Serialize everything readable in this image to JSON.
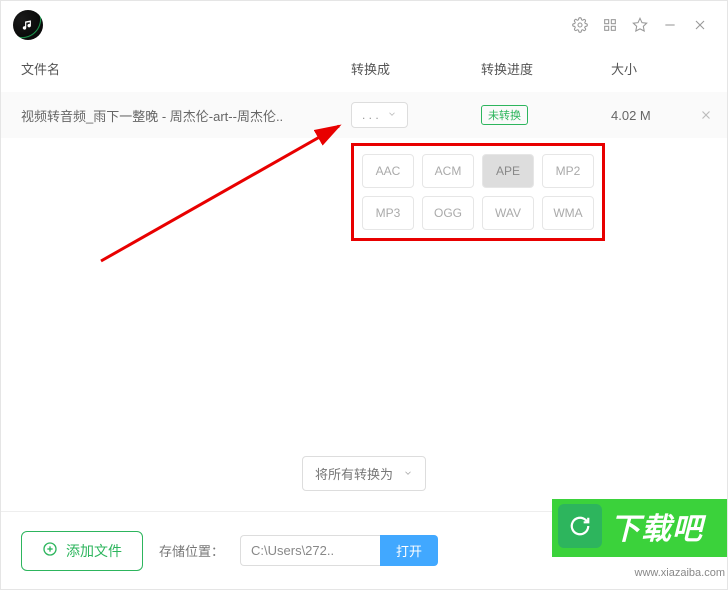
{
  "header": {
    "cols": {
      "name": "文件名",
      "format": "转换成",
      "progress": "转换进度",
      "size": "大小"
    }
  },
  "file": {
    "name": "视频转音频_雨下一整晚 - 周杰伦-art--周杰伦..",
    "format_placeholder": ". . .",
    "status": "未转换",
    "size": "4.02 M"
  },
  "formats": [
    {
      "label": "AAC",
      "selected": false
    },
    {
      "label": "ACM",
      "selected": false
    },
    {
      "label": "APE",
      "selected": true
    },
    {
      "label": "MP2",
      "selected": false
    },
    {
      "label": "MP3",
      "selected": false
    },
    {
      "label": "OGG",
      "selected": false
    },
    {
      "label": "WAV",
      "selected": false
    },
    {
      "label": "WMA",
      "selected": false
    }
  ],
  "batch": {
    "label": "将所有转换为"
  },
  "footer": {
    "add_label": "添加文件",
    "store_label": "存储位置：",
    "path": "C:\\Users\\272..",
    "open_label": "打开"
  },
  "watermark": {
    "text": "下载吧",
    "url": "www.xiazaiba.com"
  }
}
